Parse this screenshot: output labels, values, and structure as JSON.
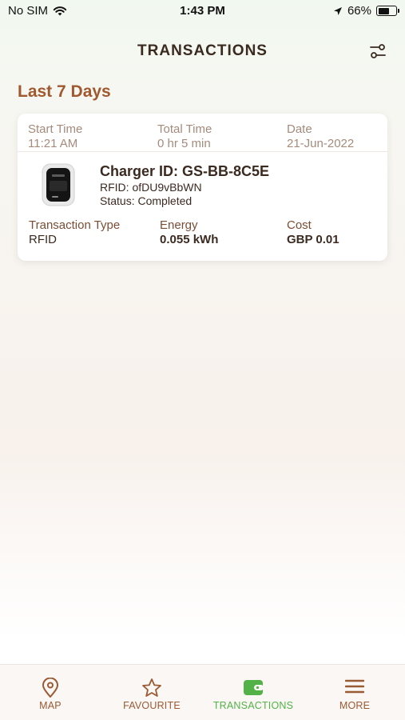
{
  "status_bar": {
    "carrier": "No SIM",
    "time": "1:43 PM",
    "battery": "66%",
    "battery_level": 0.66
  },
  "header": {
    "title": "TRANSACTIONS",
    "filter_icon": "sliders-icon"
  },
  "section_title": "Last 7 Days",
  "transaction": {
    "start_time_label": "Start Time",
    "start_time": "11:21 AM",
    "total_time_label": "Total Time",
    "total_time": "0 hr 5 min",
    "date_label": "Date",
    "date": "21-Jun-2022",
    "charger_id": "Charger ID: GS-BB-8C5E",
    "rfid": "RFID: ofDU9vBbWN",
    "status": "Status: Completed",
    "type_label": "Transaction Type",
    "type": "RFID",
    "energy_label": "Energy",
    "energy": "0.055 kWh",
    "cost_label": "Cost",
    "cost": "GBP 0.01"
  },
  "tabs": [
    {
      "label": "MAP",
      "icon": "map-pin-icon"
    },
    {
      "label": "FAVOURITE",
      "icon": "star-icon"
    },
    {
      "label": "TRANSACTIONS",
      "icon": "wallet-icon",
      "active": true
    },
    {
      "label": "MORE",
      "icon": "menu-icon"
    }
  ],
  "colors": {
    "brand_brown": "#a0582e",
    "active_green": "#52b248",
    "text_dark": "#3b2a20"
  }
}
